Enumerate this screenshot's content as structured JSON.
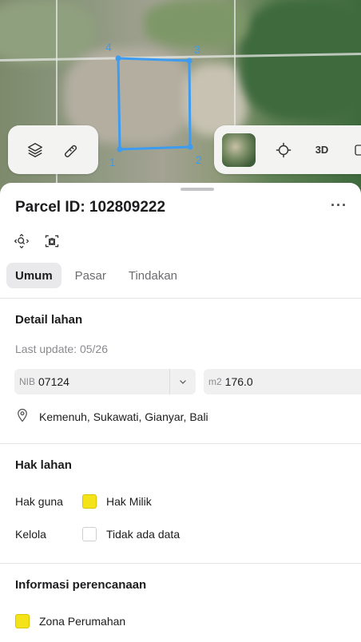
{
  "map": {
    "vertices": [
      "1",
      "2",
      "3",
      "4"
    ],
    "layers_icon": "layers-icon",
    "measure_icon": "ruler-icon",
    "locate_icon": "crosshair-icon",
    "view_3d_label": "3D"
  },
  "parcel": {
    "title": "Parcel ID: 102809222",
    "more_label": "···"
  },
  "tabs": [
    {
      "label": "Umum",
      "active": true
    },
    {
      "label": "Pasar",
      "active": false
    },
    {
      "label": "Tindakan",
      "active": false
    }
  ],
  "detail": {
    "title": "Detail lahan",
    "last_update": "Last update: 05/26",
    "nib_label": "NIB",
    "nib_value": "07124",
    "area_label": "m2",
    "area_value": "176.0",
    "location": "Kemenuh, Sukawati, Gianyar, Bali"
  },
  "hak": {
    "title": "Hak lahan",
    "rows": [
      {
        "key": "Hak guna",
        "value": "Hak Milik",
        "color": "#f5e31a"
      },
      {
        "key": "Kelola",
        "value": "Tidak ada data",
        "color": "#ffffff"
      }
    ]
  },
  "planning": {
    "title": "Informasi perencanaan",
    "zone": "Zona Perumahan",
    "zone_color": "#f5e31a"
  },
  "colors": {
    "parcel_outline": "#3d9bf0",
    "accent_yellow": "#f5e31a"
  }
}
